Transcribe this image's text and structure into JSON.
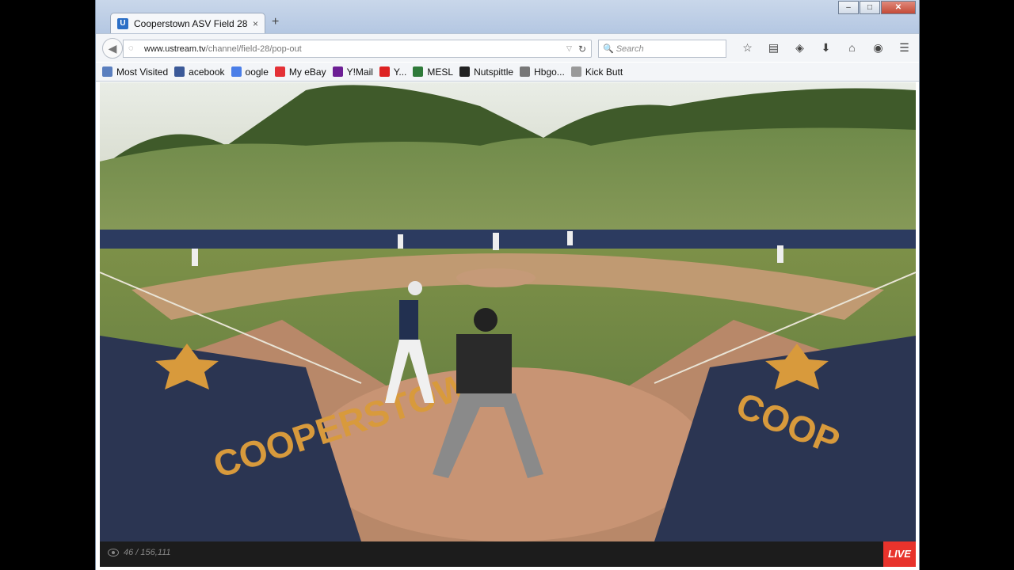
{
  "tab": {
    "title": "Cooperstown ASV Field 28 ...",
    "close": "×",
    "favicon": "U"
  },
  "new_tab": "+",
  "url": {
    "host": "www.ustream.tv",
    "path": "/channel/field-28/pop-out"
  },
  "search": {
    "placeholder": "Search"
  },
  "bookmarks": [
    {
      "label": "Most Visited",
      "icon": "bookmark-icon",
      "color": "#5a7fbf"
    },
    {
      "label": "acebook",
      "icon": "facebook-icon",
      "color": "#3b5998"
    },
    {
      "label": "oogle",
      "icon": "google-icon",
      "color": "#4a7ee8"
    },
    {
      "label": "My eBay",
      "icon": "ebay-icon",
      "color": "#e43137"
    },
    {
      "label": "Y!Mail",
      "icon": "mail-icon",
      "color": "#6d1f95"
    },
    {
      "label": "Y...",
      "icon": "youtube-icon",
      "color": "#d22"
    },
    {
      "label": "MESL",
      "icon": "mesl-icon",
      "color": "#2f7a3a"
    },
    {
      "label": "Nutspittle",
      "icon": "n-icon",
      "color": "#222"
    },
    {
      "label": "Hbgo...",
      "icon": "hbgo-icon",
      "color": "#777"
    },
    {
      "label": "Kick Butt",
      "icon": "page-icon",
      "color": "#999"
    }
  ],
  "player": {
    "viewers": "46 / 156,111",
    "live_label": "LIVE"
  },
  "field_text": {
    "left": "COOPERSTOWN",
    "right": "COOP"
  }
}
